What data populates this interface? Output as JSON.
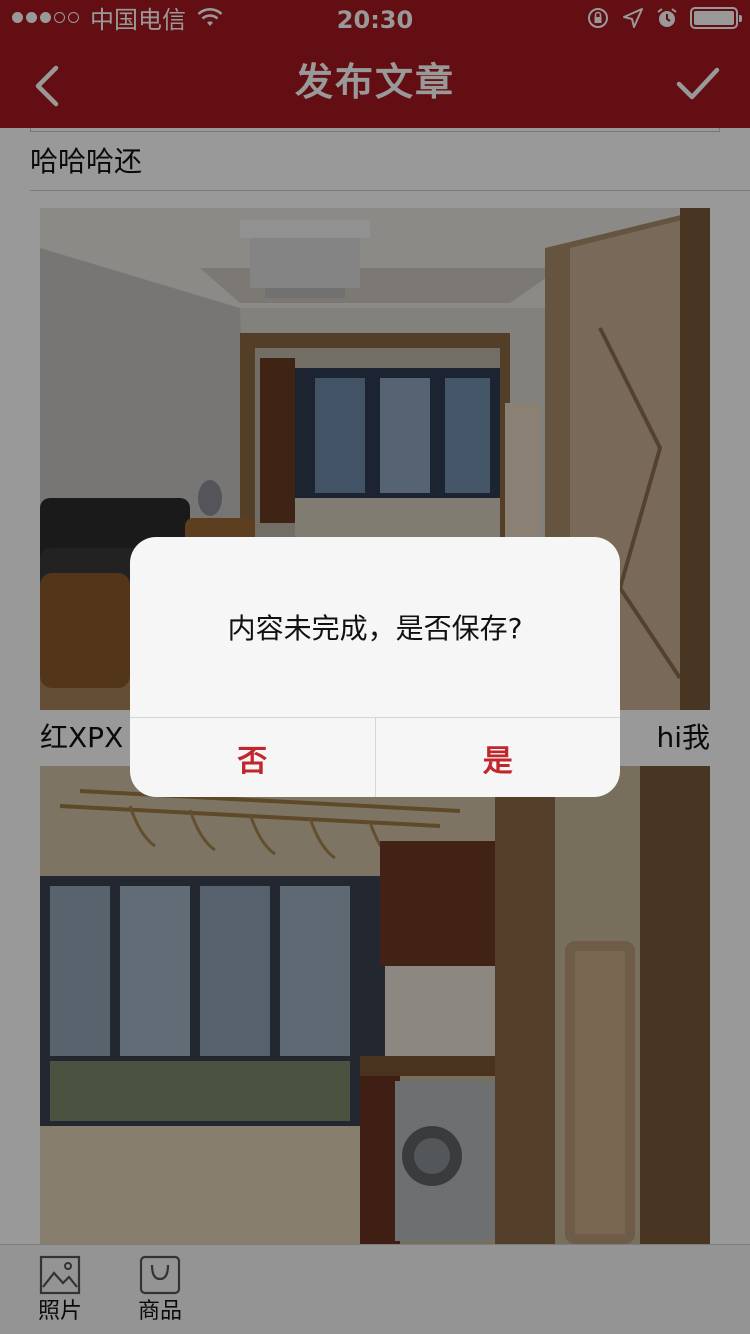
{
  "status_bar": {
    "carrier": "中国电信",
    "time": "20:30",
    "signal_bars_filled": 3,
    "signal_bars_total": 5
  },
  "nav": {
    "title": "发布文章",
    "back_icon": "chevron-left-icon",
    "done_icon": "checkmark-icon"
  },
  "article": {
    "text": "哈哈哈还",
    "caption_left": "红XPX",
    "caption_right": "hi我"
  },
  "toolbar": {
    "items": [
      {
        "label": "照片",
        "icon": "photo-icon"
      },
      {
        "label": "商品",
        "icon": "shopping-bag-icon"
      }
    ]
  },
  "dialog": {
    "message": "内容未完成，是否保存?",
    "no_label": "否",
    "yes_label": "是"
  },
  "colors": {
    "brand": "#a5181f",
    "dialog_button": "#c0262c",
    "overlay": "rgba(0,0,0,0.40)"
  }
}
